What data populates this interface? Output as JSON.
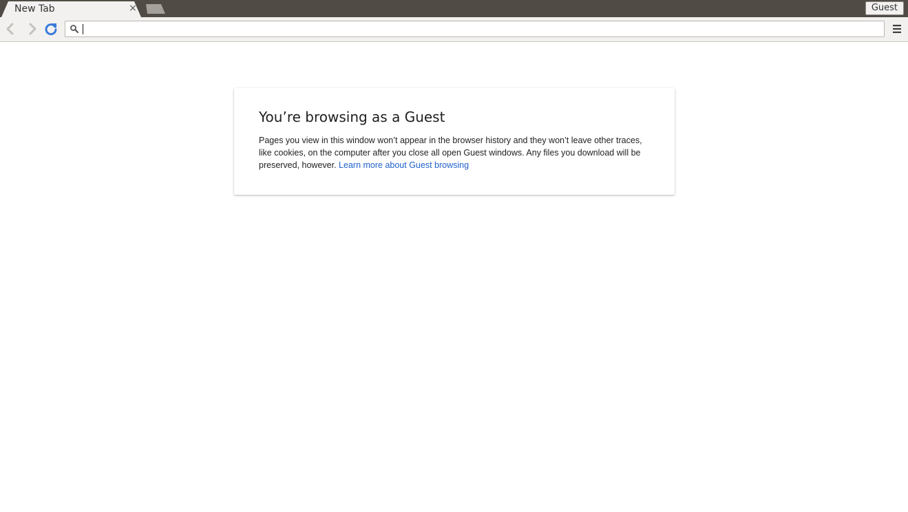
{
  "browser": {
    "tab": {
      "title": "New Tab",
      "close_glyph": "×"
    },
    "profile_button": "Guest",
    "omnibox": {
      "value": "",
      "placeholder": ""
    },
    "icons": {
      "back": "back-arrow-icon",
      "forward": "forward-arrow-icon",
      "reload": "reload-icon",
      "search": "search-icon",
      "menu": "hamburger-menu-icon"
    }
  },
  "guest_card": {
    "title": "You’re browsing as a Guest",
    "body": "Pages you view in this window won’t appear in the browser history and they won’t leave other traces, like cookies, on the computer after you close all open Guest windows. Any files you download will be preserved, however.",
    "link": "Learn more about Guest browsing"
  },
  "colors": {
    "tabstrip_bg": "#504c45",
    "toolbar_bg": "#f2f1f0",
    "link": "#2162cd",
    "reload_blue": "#3b7bd8"
  }
}
